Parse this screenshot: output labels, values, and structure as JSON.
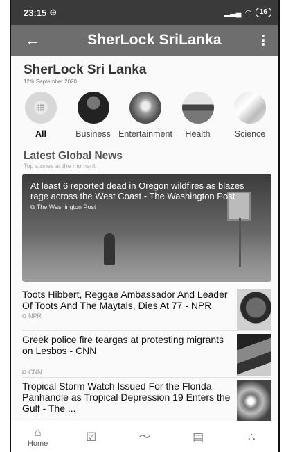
{
  "status": {
    "time": "23:15",
    "battery": "16"
  },
  "appbar": {
    "title": "SherLock SriLanka"
  },
  "header": {
    "brand": "SherLock Sri Lanka",
    "date": "12th September 2020"
  },
  "categories": [
    {
      "label": "All"
    },
    {
      "label": "Business"
    },
    {
      "label": "Entertainment"
    },
    {
      "label": "Health"
    },
    {
      "label": "Science"
    }
  ],
  "section": {
    "title": "Latest Global News",
    "subtitle": "Top stories at the moment"
  },
  "hero": {
    "headline": "At least 6 reported dead in Oregon wildfires as blazes rage across the West Coast - The Washington Post",
    "source": "The Washington Post"
  },
  "articles": [
    {
      "title": "Toots Hibbert, Reggae Ambassador And Leader Of Toots And The Maytals, Dies At 77 - NPR",
      "source": "NPR"
    },
    {
      "title": "Greek police fire teargas at protesting migrants on Lesbos - CNN",
      "source": "CNN"
    },
    {
      "title": "Tropical Storm Watch Issued For the Florida Panhandle as Tropical Depression 19 Enters the Gulf - The ...",
      "source": ""
    }
  ],
  "nav": {
    "home": "Home"
  }
}
